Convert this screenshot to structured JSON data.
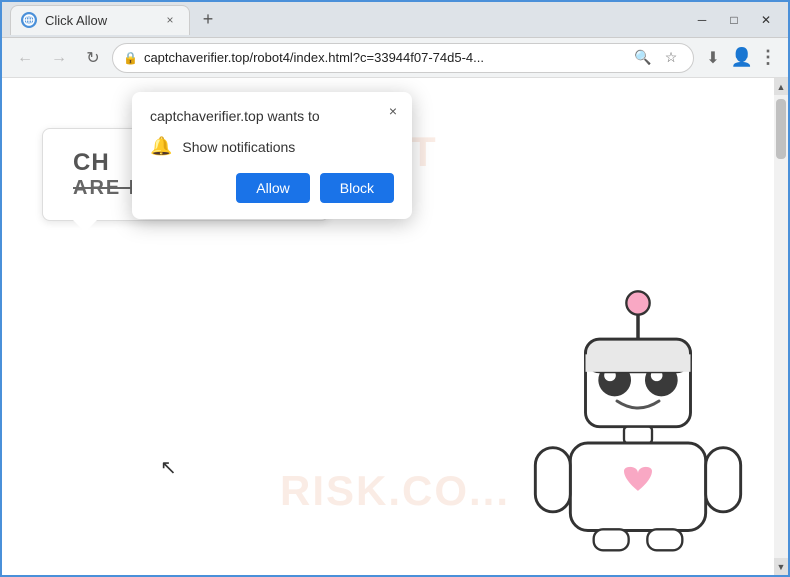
{
  "browser": {
    "title_bar": {
      "tab_favicon": "⊕",
      "tab_title": "Click Allow",
      "close_tab_label": "×",
      "new_tab_label": "+",
      "minimize_label": "─",
      "maximize_label": "□",
      "close_window_label": "✕"
    },
    "nav": {
      "back_label": "←",
      "forward_label": "→",
      "reload_label": "↻",
      "address": "captchaverifier.top/robot4/index.html?c=33944f07-74d5-4...",
      "search_icon_label": "🔍",
      "bookmark_icon_label": "☆",
      "profile_icon_label": "👤",
      "menu_icon_label": "⋮",
      "download_icon": "⬇"
    }
  },
  "permission_dialog": {
    "site_text": "captchaverifier.top wants to",
    "close_label": "×",
    "permission_icon": "🔔",
    "permission_text": "Show notifications",
    "allow_label": "Allow",
    "block_label": "Block"
  },
  "page": {
    "captcha_title": "CH",
    "captcha_subtitle": "ARE NOT A ROBOT!",
    "watermark_top": "PTT",
    "watermark_bottom": "RISK.CO..."
  }
}
